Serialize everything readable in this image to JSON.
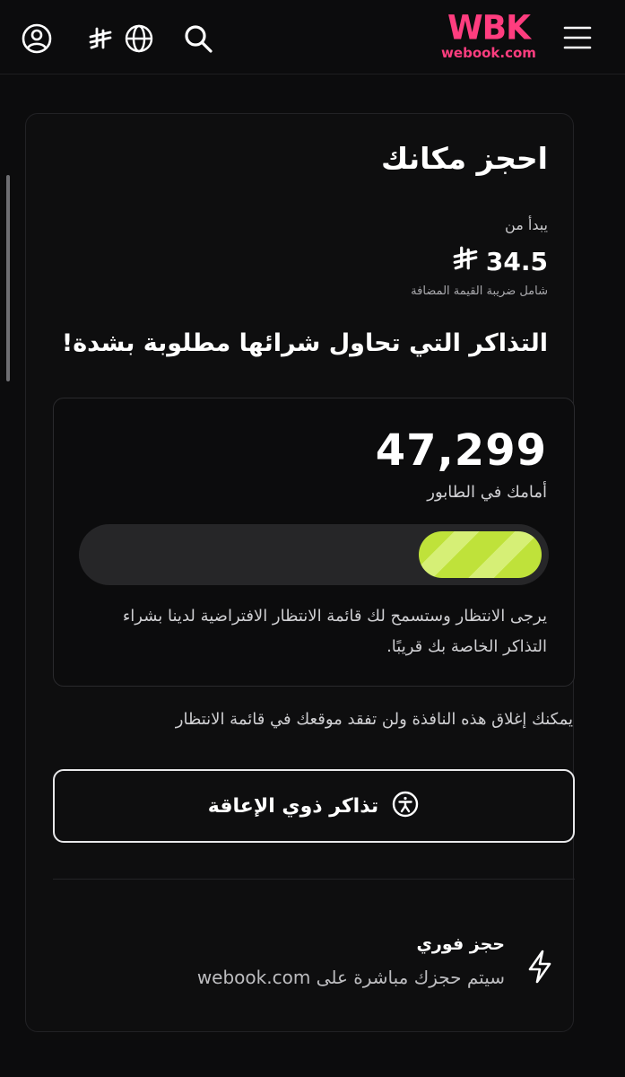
{
  "header": {
    "logo_mark": "WBK",
    "logo_domain": "webook.com",
    "icons": [
      "profile-icon",
      "riyal-currency-icon",
      "globe-icon",
      "search-icon",
      "menu-icon"
    ]
  },
  "booking": {
    "title": "احجز مكانك",
    "starts_from": "يبدأ من",
    "price": "34.5",
    "currency_icon": "riyal-currency-icon",
    "vat_note": "شامل ضريبة القيمة المضافة",
    "demand_heading": "التذاكر التي تحاول شرائها مطلوبة بشدة!"
  },
  "queue": {
    "position": "47,299",
    "position_label": "أمامك في الطابور",
    "progress_percent": 27,
    "message": "يرجى الانتظار وستسمح لك قائمة الانتظار الافتراضية لدينا بشراء التذاكر الخاصة بك قريبًا."
  },
  "close_note": "يمكنك إغلاق هذه النافذة ولن تفقد موقعك في قائمة الانتظار",
  "accessibility_button": {
    "label": "تذاكر ذوي الإعاقة",
    "icon": "accessibility-icon"
  },
  "instant_booking": {
    "title": "حجز فوري",
    "description": "سيتم حجزك مباشرة على webook.com",
    "icon": "lightning-icon"
  },
  "colors": {
    "background": "#0c0c0d",
    "brand": "#ff3d7f",
    "progress": "#bfe23a"
  }
}
